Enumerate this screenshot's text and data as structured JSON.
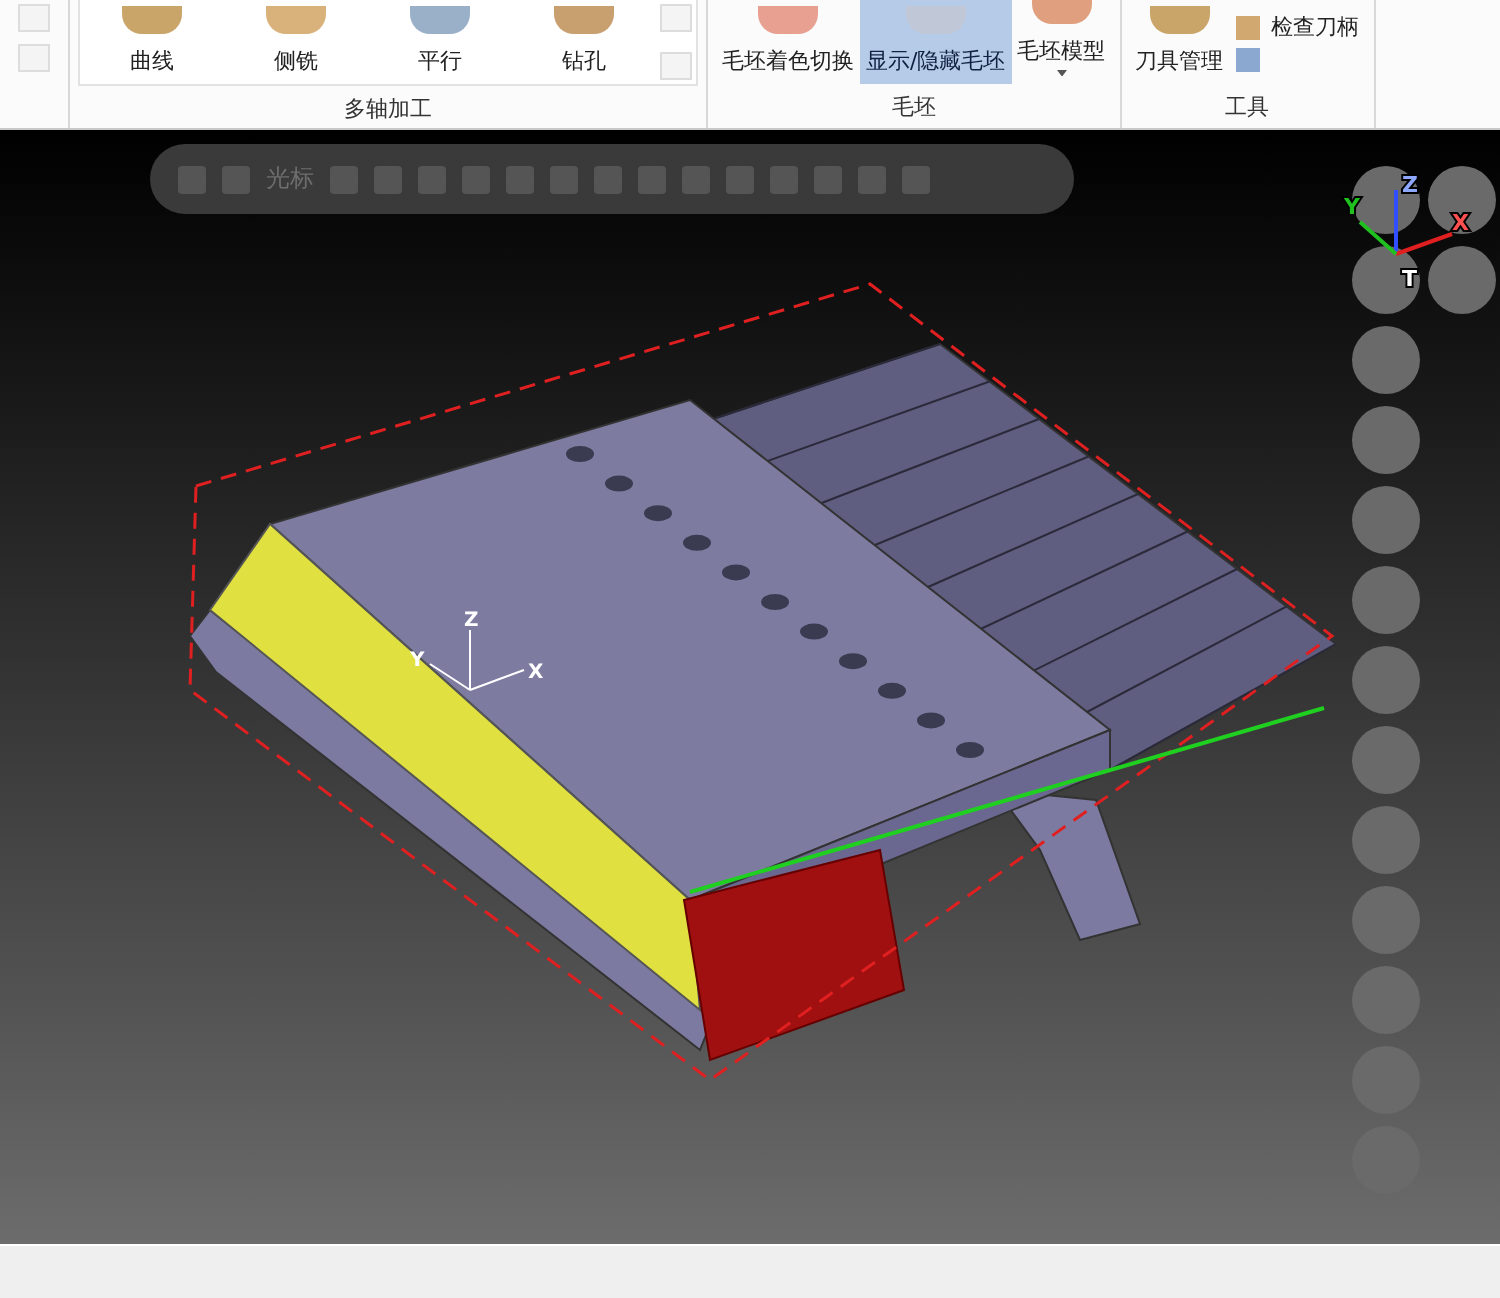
{
  "ribbon": {
    "groups": [
      {
        "label": "多轴加工",
        "buttons": [
          {
            "label": "曲线",
            "kind": "large",
            "selected": false
          },
          {
            "label": "侧铣",
            "kind": "large",
            "selected": false
          },
          {
            "label": "平行",
            "kind": "large",
            "selected": false
          },
          {
            "label": "钻孔",
            "kind": "large",
            "selected": false
          }
        ]
      },
      {
        "label": "毛坯",
        "buttons": [
          {
            "label": "毛坯着色切换",
            "kind": "large",
            "selected": false
          },
          {
            "label": "显示/隐藏毛坯",
            "kind": "large",
            "selected": true
          },
          {
            "label": "毛坯模型",
            "kind": "dropdown",
            "selected": false
          }
        ]
      },
      {
        "label": "工具",
        "buttons": [
          {
            "label": "刀具管理",
            "kind": "large",
            "selected": false
          },
          {
            "kind": "icons"
          },
          {
            "label": "检查刀柄",
            "kind": "small",
            "selected": false
          }
        ]
      }
    ]
  },
  "viewport": {
    "toolbar": {
      "cursor_label": "光标"
    },
    "view_triad": {
      "x": "X",
      "y": "Y",
      "z": "Z"
    },
    "tool_marker": "T",
    "model_triad": {
      "x": "X",
      "y": "Y",
      "z": "Z"
    }
  }
}
